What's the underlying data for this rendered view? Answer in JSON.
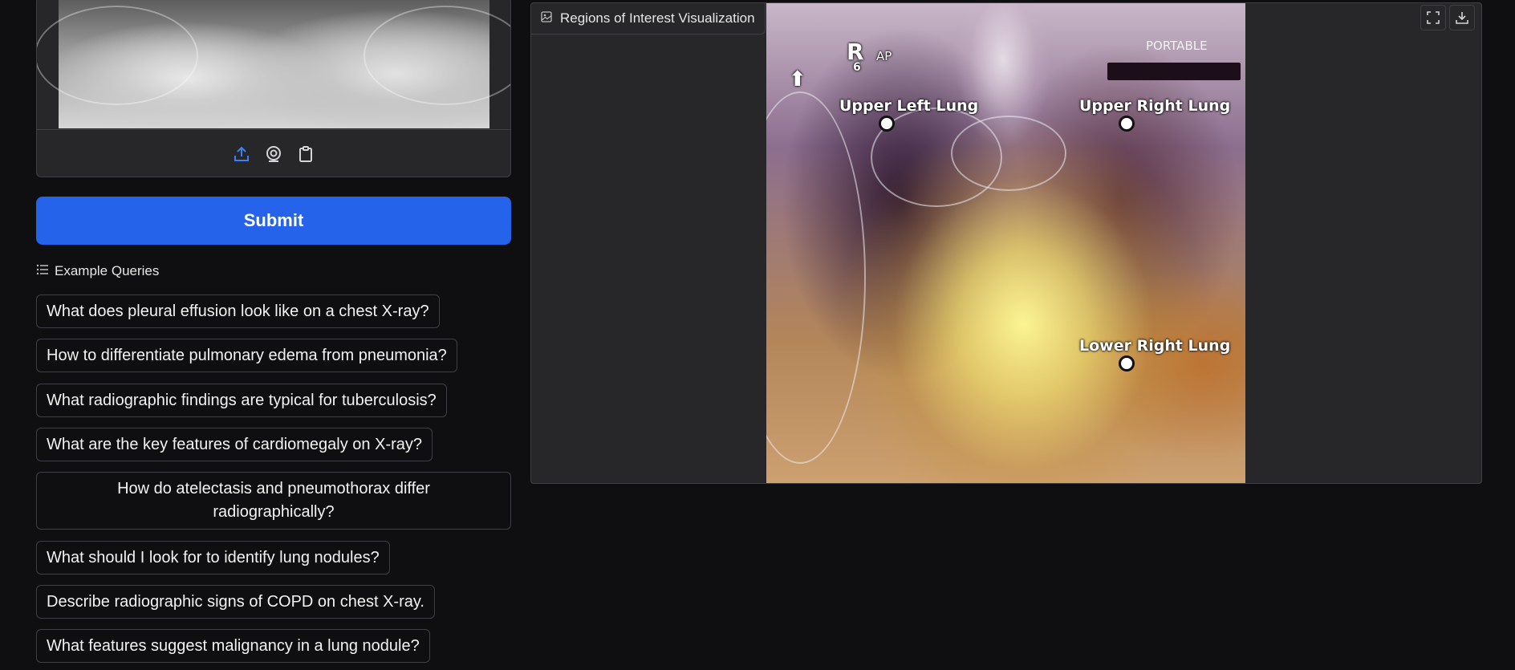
{
  "upload": {
    "toolbar": {
      "upload_icon": "upload-icon",
      "webcam_icon": "webcam-icon",
      "clipboard_icon": "clipboard-icon"
    }
  },
  "submit": {
    "label": "Submit"
  },
  "examples": {
    "header": "Example Queries",
    "items": [
      "What does pleural effusion look like on a chest X-ray?",
      "How to differentiate pulmonary edema from pneumonia?",
      "What radiographic findings are typical for tuberculosis?",
      "What are the key features of cardiomegaly on X-ray?",
      "How do atelectasis and pneumothorax differ radiographically?",
      "What should I look for to identify lung nodules?",
      "Describe radiographic signs of COPD on chest X-ray.",
      "What features suggest malignancy in a lung nodule?"
    ]
  },
  "roi": {
    "title": "Regions of Interest Visualization",
    "image_text": {
      "marker_r": "R",
      "marker_6": "6",
      "ap": "AP",
      "portable": "PORTABLE"
    },
    "regions": {
      "upper_left": "Upper Left Lung",
      "upper_right": "Upper Right Lung",
      "lower_right": "Lower Right Lung"
    }
  },
  "colors": {
    "accent": "#2563eb",
    "background": "#0f0f11",
    "panel": "#27272a",
    "border": "#3f3f46"
  }
}
